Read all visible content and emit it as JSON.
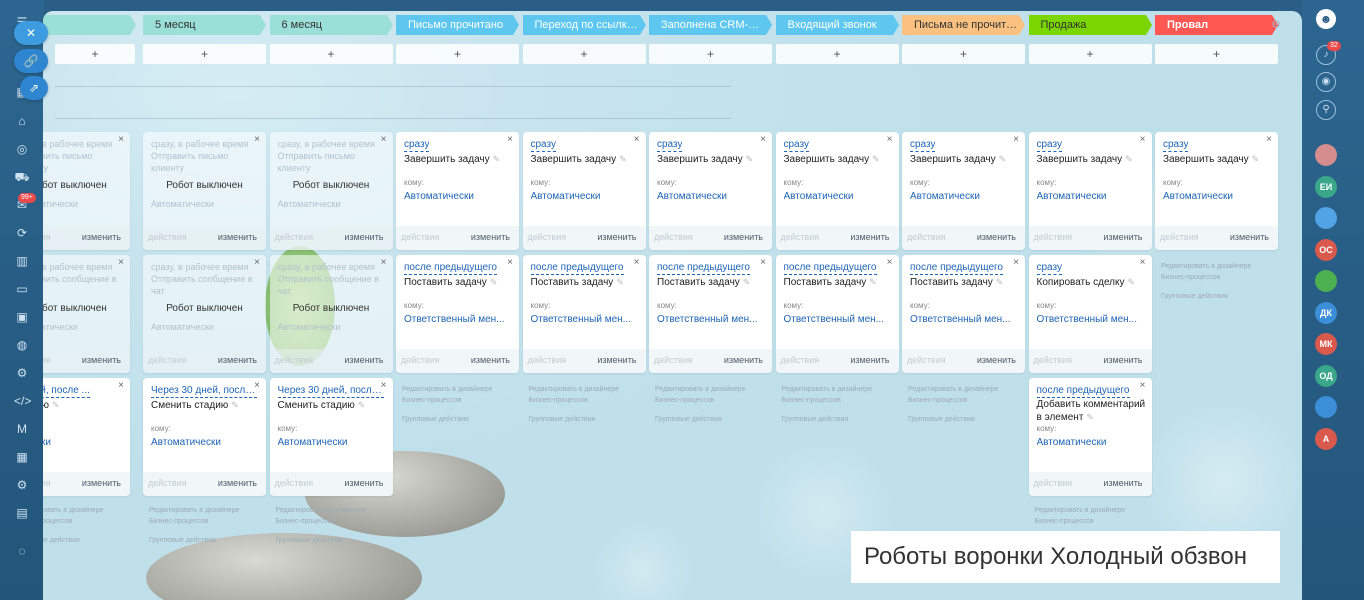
{
  "stages": [
    {
      "label": "",
      "color": "#9be0d8"
    },
    {
      "label": "5 месяц",
      "color": "#9be0d8"
    },
    {
      "label": "6 месяц",
      "color": "#9be0d8"
    },
    {
      "label": "Письмо прочитано",
      "color": "#5dc7ef"
    },
    {
      "label": "Переход по ссылке из ...",
      "color": "#5dc7ef"
    },
    {
      "label": "Заполнена CRM-форма",
      "color": "#5dc7ef"
    },
    {
      "label": "Входящий звонок",
      "color": "#5dc7ef"
    },
    {
      "label": "Письма не прочитаны",
      "color": "#fbc181"
    },
    {
      "label": "Продажа",
      "color": "#7bd500"
    },
    {
      "label": "Провал",
      "color": "#ff5752"
    }
  ],
  "add_label": "+",
  "card": {
    "komu": "кому:",
    "actions": "действия",
    "edit": "изменить",
    "robot_off": "Робот выключен",
    "close": "×",
    "pencil": "✎"
  },
  "row1": {
    "ghost_a": "сразу, в рабочее время",
    "ghost_b": "Отправить письмо клиенту",
    "ghost_c": "Автоматически",
    "when": "сразу",
    "action": "Завершить задачу",
    "who": "Автоматически"
  },
  "row2": {
    "ghost_a": "сразу, в рабочее время",
    "ghost_b": "Отправить сообщение в чат",
    "ghost_c": "Автоматически",
    "when": "после предыдущего",
    "action": "Поставить задачу",
    "who": "Ответственный мен...",
    "sale_when": "сразу",
    "sale_action": "Копировать сделку"
  },
  "row3": {
    "when_short": "0 дней, после ...",
    "when": "Через 30 дней, после ...",
    "action": "Сменить стадию",
    "action_short": "стадию",
    "who": "Автоматически",
    "who_short": "тически",
    "sale_when": "после предыдущего",
    "sale_action": "Добавить комментарий в элемент"
  },
  "links": {
    "edit_designer": "Редактировать в дизайнере",
    "bp": "Бизнес-процессов",
    "group": "Групповые действия"
  },
  "caption": "Роботы воронки Холодный обзвон",
  "notifications": {
    "count": "32"
  },
  "left_badge": "99+",
  "avatars": [
    {
      "initials": "",
      "color": "#d58d8d"
    },
    {
      "initials": "ЕИ",
      "color": "#3aa68a"
    },
    {
      "initials": "",
      "color": "#51a3e6"
    },
    {
      "initials": "ОС",
      "color": "#d9594c"
    },
    {
      "initials": "",
      "color": "#4caf50"
    },
    {
      "initials": "ДК",
      "color": "#3b8ed8"
    },
    {
      "initials": "МК",
      "color": "#d9594c"
    },
    {
      "initials": "ОД",
      "color": "#3aa68a"
    },
    {
      "initials": "",
      "color": "#3b8ed8"
    },
    {
      "initials": "А",
      "color": "#d9594c"
    }
  ]
}
